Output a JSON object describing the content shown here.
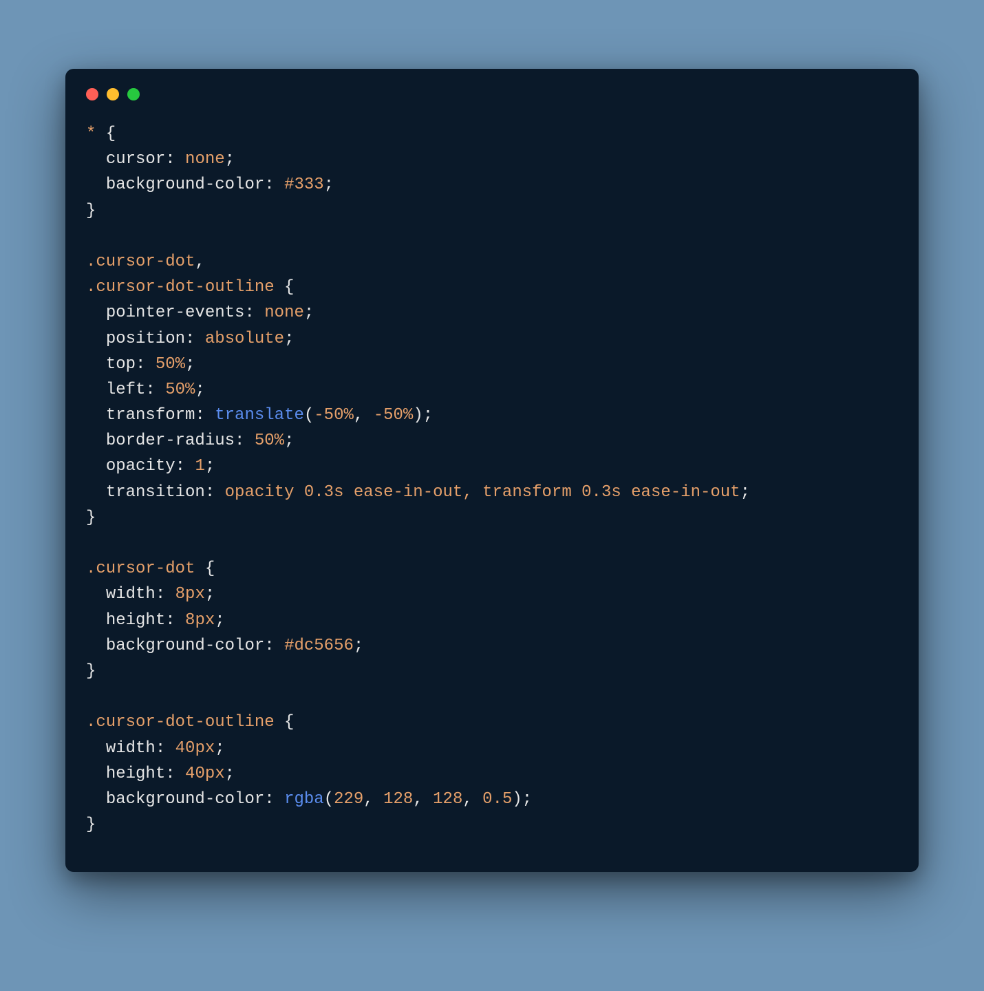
{
  "colors": {
    "page_bg": "#6e95b6",
    "window_bg": "#0a1929",
    "traffic_red": "#ff5f56",
    "traffic_yellow": "#ffbd2e",
    "traffic_green": "#27c93f",
    "token_selector": "#e6a06a",
    "token_property": "#e6e6e6",
    "token_value_keyword": "#e6a06a",
    "token_number": "#e6a06a",
    "token_function": "#5b8def",
    "token_punctuation": "#e6e6e6"
  },
  "code": {
    "language": "css",
    "tokens": [
      {
        "t": "sel",
        "v": "*"
      },
      {
        "t": "punc",
        "v": " {"
      },
      {
        "t": "nl"
      },
      {
        "t": "indent"
      },
      {
        "t": "prop",
        "v": "cursor"
      },
      {
        "t": "punc",
        "v": ": "
      },
      {
        "t": "kw",
        "v": "none"
      },
      {
        "t": "punc",
        "v": ";"
      },
      {
        "t": "nl"
      },
      {
        "t": "indent"
      },
      {
        "t": "prop",
        "v": "background-color"
      },
      {
        "t": "punc",
        "v": ": "
      },
      {
        "t": "num",
        "v": "#333"
      },
      {
        "t": "punc",
        "v": ";"
      },
      {
        "t": "nl"
      },
      {
        "t": "punc",
        "v": "}"
      },
      {
        "t": "nl"
      },
      {
        "t": "nl"
      },
      {
        "t": "sel",
        "v": ".cursor-dot"
      },
      {
        "t": "punc",
        "v": ","
      },
      {
        "t": "nl"
      },
      {
        "t": "sel",
        "v": ".cursor-dot-outline"
      },
      {
        "t": "punc",
        "v": " {"
      },
      {
        "t": "nl"
      },
      {
        "t": "indent"
      },
      {
        "t": "prop",
        "v": "pointer-events"
      },
      {
        "t": "punc",
        "v": ": "
      },
      {
        "t": "kw",
        "v": "none"
      },
      {
        "t": "punc",
        "v": ";"
      },
      {
        "t": "nl"
      },
      {
        "t": "indent"
      },
      {
        "t": "prop",
        "v": "position"
      },
      {
        "t": "punc",
        "v": ": "
      },
      {
        "t": "kw",
        "v": "absolute"
      },
      {
        "t": "punc",
        "v": ";"
      },
      {
        "t": "nl"
      },
      {
        "t": "indent"
      },
      {
        "t": "prop",
        "v": "top"
      },
      {
        "t": "punc",
        "v": ": "
      },
      {
        "t": "num",
        "v": "50%"
      },
      {
        "t": "punc",
        "v": ";"
      },
      {
        "t": "nl"
      },
      {
        "t": "indent"
      },
      {
        "t": "prop",
        "v": "left"
      },
      {
        "t": "punc",
        "v": ": "
      },
      {
        "t": "num",
        "v": "50%"
      },
      {
        "t": "punc",
        "v": ";"
      },
      {
        "t": "nl"
      },
      {
        "t": "indent"
      },
      {
        "t": "prop",
        "v": "transform"
      },
      {
        "t": "punc",
        "v": ": "
      },
      {
        "t": "func",
        "v": "translate"
      },
      {
        "t": "punc",
        "v": "("
      },
      {
        "t": "num",
        "v": "-50%"
      },
      {
        "t": "punc",
        "v": ", "
      },
      {
        "t": "num",
        "v": "-50%"
      },
      {
        "t": "punc",
        "v": ");"
      },
      {
        "t": "nl"
      },
      {
        "t": "indent"
      },
      {
        "t": "prop",
        "v": "border-radius"
      },
      {
        "t": "punc",
        "v": ": "
      },
      {
        "t": "num",
        "v": "50%"
      },
      {
        "t": "punc",
        "v": ";"
      },
      {
        "t": "nl"
      },
      {
        "t": "indent"
      },
      {
        "t": "prop",
        "v": "opacity"
      },
      {
        "t": "punc",
        "v": ": "
      },
      {
        "t": "num",
        "v": "1"
      },
      {
        "t": "punc",
        "v": ";"
      },
      {
        "t": "nl"
      },
      {
        "t": "indent"
      },
      {
        "t": "prop",
        "v": "transition"
      },
      {
        "t": "punc",
        "v": ": "
      },
      {
        "t": "kw",
        "v": "opacity 0.3s ease-in-out, transform 0.3s ease-in-out"
      },
      {
        "t": "punc",
        "v": ";"
      },
      {
        "t": "nl"
      },
      {
        "t": "punc",
        "v": "}"
      },
      {
        "t": "nl"
      },
      {
        "t": "nl"
      },
      {
        "t": "sel",
        "v": ".cursor-dot"
      },
      {
        "t": "punc",
        "v": " {"
      },
      {
        "t": "nl"
      },
      {
        "t": "indent"
      },
      {
        "t": "prop",
        "v": "width"
      },
      {
        "t": "punc",
        "v": ": "
      },
      {
        "t": "num",
        "v": "8px"
      },
      {
        "t": "punc",
        "v": ";"
      },
      {
        "t": "nl"
      },
      {
        "t": "indent"
      },
      {
        "t": "prop",
        "v": "height"
      },
      {
        "t": "punc",
        "v": ": "
      },
      {
        "t": "num",
        "v": "8px"
      },
      {
        "t": "punc",
        "v": ";"
      },
      {
        "t": "nl"
      },
      {
        "t": "indent"
      },
      {
        "t": "prop",
        "v": "background-color"
      },
      {
        "t": "punc",
        "v": ": "
      },
      {
        "t": "num",
        "v": "#dc5656"
      },
      {
        "t": "punc",
        "v": ";"
      },
      {
        "t": "nl"
      },
      {
        "t": "punc",
        "v": "}"
      },
      {
        "t": "nl"
      },
      {
        "t": "nl"
      },
      {
        "t": "sel",
        "v": ".cursor-dot-outline"
      },
      {
        "t": "punc",
        "v": " {"
      },
      {
        "t": "nl"
      },
      {
        "t": "indent"
      },
      {
        "t": "prop",
        "v": "width"
      },
      {
        "t": "punc",
        "v": ": "
      },
      {
        "t": "num",
        "v": "40px"
      },
      {
        "t": "punc",
        "v": ";"
      },
      {
        "t": "nl"
      },
      {
        "t": "indent"
      },
      {
        "t": "prop",
        "v": "height"
      },
      {
        "t": "punc",
        "v": ": "
      },
      {
        "t": "num",
        "v": "40px"
      },
      {
        "t": "punc",
        "v": ";"
      },
      {
        "t": "nl"
      },
      {
        "t": "indent"
      },
      {
        "t": "prop",
        "v": "background-color"
      },
      {
        "t": "punc",
        "v": ": "
      },
      {
        "t": "func",
        "v": "rgba"
      },
      {
        "t": "punc",
        "v": "("
      },
      {
        "t": "num",
        "v": "229"
      },
      {
        "t": "punc",
        "v": ", "
      },
      {
        "t": "num",
        "v": "128"
      },
      {
        "t": "punc",
        "v": ", "
      },
      {
        "t": "num",
        "v": "128"
      },
      {
        "t": "punc",
        "v": ", "
      },
      {
        "t": "num",
        "v": "0.5"
      },
      {
        "t": "punc",
        "v": ");"
      },
      {
        "t": "nl"
      },
      {
        "t": "punc",
        "v": "}"
      }
    ]
  }
}
